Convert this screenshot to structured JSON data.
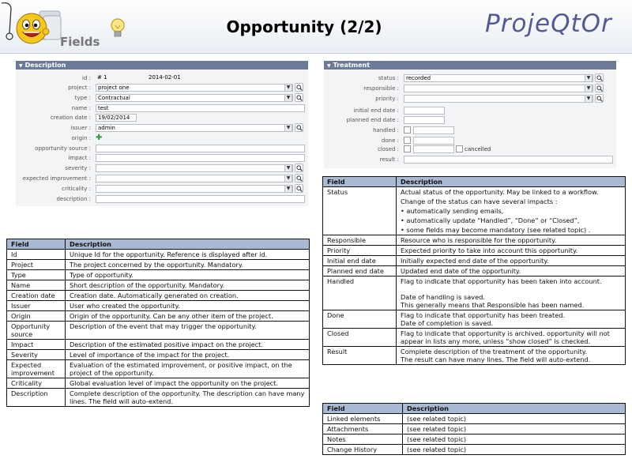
{
  "header": {
    "logo_label": "Fields",
    "title": "Opportunity (2/2)",
    "brand": "ProjeQtOr"
  },
  "description_panel": {
    "title": "Description",
    "fields": [
      {
        "label": "id :",
        "value": "# 1",
        "extra": "2014-02-01"
      },
      {
        "label": "project :",
        "value": "project one"
      },
      {
        "label": "type :",
        "value": "Contractual"
      },
      {
        "label": "name :",
        "value": "test"
      },
      {
        "label": "creation date :",
        "value": "19/02/2014"
      },
      {
        "label": "issuer :",
        "value": "admin"
      },
      {
        "label": "origin :",
        "value": ""
      },
      {
        "label": "opportunity source :",
        "value": ""
      },
      {
        "label": "impact :",
        "value": ""
      },
      {
        "label": "severity :",
        "value": ""
      },
      {
        "label": "expected improvement :",
        "value": ""
      },
      {
        "label": "criticality :",
        "value": ""
      },
      {
        "label": "description :",
        "value": ""
      }
    ]
  },
  "treatment_panel": {
    "title": "Treatment",
    "fields": [
      {
        "label": "status :",
        "value": "recorded"
      },
      {
        "label": "responsible :",
        "value": ""
      },
      {
        "label": "priority :",
        "value": ""
      },
      {
        "label": "initial end date :",
        "value": ""
      },
      {
        "label": "planned end date :",
        "value": ""
      },
      {
        "label": "handled :",
        "value": ""
      },
      {
        "label": "done :",
        "value": ""
      },
      {
        "label": "closed :",
        "value": "",
        "extra": "cancelled"
      },
      {
        "label": "result :",
        "value": ""
      }
    ]
  },
  "left_table": {
    "headers": [
      "Field",
      "Description"
    ],
    "rows": [
      {
        "field": "Id",
        "desc": [
          "Unique Id for the opportunity. Reference is displayed after id."
        ]
      },
      {
        "field": "Project",
        "desc": [
          "The project concerned by the opportunity. Mandatory."
        ]
      },
      {
        "field": "Type",
        "desc": [
          "Type of opportunity."
        ]
      },
      {
        "field": "Name",
        "desc": [
          "Short description of the opportunity. Mandatory."
        ]
      },
      {
        "field": "Creation date",
        "desc": [
          "Creation date. Automatically generated on creation."
        ]
      },
      {
        "field": "Issuer",
        "desc": [
          "User who created the opportunity."
        ]
      },
      {
        "field": "Origin",
        "desc": [
          "Origin of the opportunity. Can be any other item of the project."
        ]
      },
      {
        "field": "Opportunity source",
        "desc": [
          "Description of the event that may trigger the opportunity."
        ]
      },
      {
        "field": "Impact",
        "desc": [
          "Description of the estimated positive impact on the project."
        ]
      },
      {
        "field": "Severity",
        "desc": [
          "Level of importance of the impact for the project."
        ]
      },
      {
        "field": "Expected improvement",
        "desc": [
          "Evaluation of the estimated improvement, or positive impact, on the project of the opportunity."
        ]
      },
      {
        "field": "Criticality",
        "desc": [
          "Global evaluation level of impact the opportunity on the project."
        ]
      },
      {
        "field": "Description",
        "desc": [
          "Complete description of the opportunity. The description can have many lines. The field will auto-extend."
        ]
      }
    ]
  },
  "right_table": {
    "headers": [
      "Field",
      "Description"
    ],
    "rows": [
      {
        "field": "Status",
        "desc": [
          "Actual status of the opportunity. May be linked to a workflow.",
          "Change of the status can have several impacts :",
          "• automatically sending emails,",
          "• automatically update “Handled”, “Done” or “Closed”,",
          "• some fields may become mandatory (see related topic) ."
        ]
      },
      {
        "field": "Responsible",
        "desc": [
          "Resource who is responsible for the opportunity."
        ]
      },
      {
        "field": "Priority",
        "desc": [
          "Expected priority to take into account this opportunity."
        ]
      },
      {
        "field": "Initial end date",
        "desc": [
          "Initially expected end date of the opportunity."
        ]
      },
      {
        "field": "Planned end date",
        "desc": [
          "Updated end date of the opportunity."
        ]
      },
      {
        "field": "Handled",
        "desc": [
          "Flag to indicate that opportunity has been taken into account.",
          "",
          "Date of handling is saved.",
          "This generally means that Responsible has been named."
        ]
      },
      {
        "field": "Done",
        "desc": [
          "Flag to indicate that opportunity has been treated.",
          "Date of completion is saved."
        ]
      },
      {
        "field": "Closed",
        "desc": [
          "Flag to indicate that opportunity is archived. opportunity will not appear in lists any more, unless “show closed” is checked."
        ]
      },
      {
        "field": "Result",
        "desc": [
          "Complete description of the treatment of the opportunity.",
          "The result can have many lines. The field will auto-extend."
        ]
      }
    ]
  },
  "bottom_table": {
    "headers": [
      "Field",
      "Description"
    ],
    "rows": [
      {
        "field": "Linked elements",
        "desc": "(see related topic)"
      },
      {
        "field": "Attachments",
        "desc": "(see related topic)"
      },
      {
        "field": "Notes",
        "desc": "(see related topic)"
      },
      {
        "field": "Change History",
        "desc": "(see related topic)"
      }
    ]
  },
  "colors": {
    "panel_title_bg": "#6d7a97",
    "table_header_bg": "#a9b8d3",
    "brand": "#545a93"
  }
}
